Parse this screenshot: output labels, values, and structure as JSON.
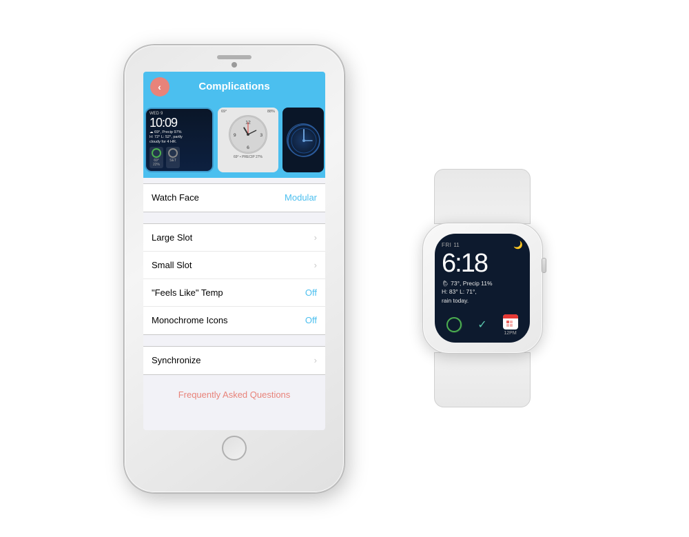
{
  "scene": {
    "background": "#ffffff"
  },
  "iphone": {
    "navbar": {
      "title": "Complications",
      "back_button": "←"
    },
    "watch_faces": {
      "face1": {
        "day": "WED",
        "date": "9",
        "time": "10:09",
        "weather": "69°, Precip 97%",
        "weather2": "H: 72° L: 52°, partly",
        "weather3": "cloudy for 4 HR.",
        "bottom1": "69°",
        "bottom2": "22%",
        "bottom3": "SET"
      }
    },
    "settings": {
      "watch_face_label": "Watch Face",
      "watch_face_value": "Modular",
      "large_slot_label": "Large Slot",
      "small_slot_label": "Small Slot",
      "feels_like_label": "\"Feels Like\" Temp",
      "feels_like_value": "Off",
      "monochrome_label": "Monochrome Icons",
      "monochrome_value": "Off",
      "synchronize_label": "Synchronize",
      "faq_label": "Frequently Asked Questions"
    }
  },
  "apple_watch": {
    "screen": {
      "date_day": "FRI",
      "date_num": "11",
      "time": "6:18",
      "weather_line1": "🌦 73°, Precip 11%",
      "weather_line2": "H: 83° L: 71°,",
      "weather_line3": "rain today.",
      "comp_cal_time": "12PM",
      "moon_icon": "🌙"
    }
  },
  "colors": {
    "ios_blue": "#4bbfef",
    "back_button": "#e8837a",
    "off_blue": "#4bbfef",
    "faq_red": "#e8837a",
    "chevron": "#c8c8c8",
    "watch_bg": "#0d1a2e"
  }
}
